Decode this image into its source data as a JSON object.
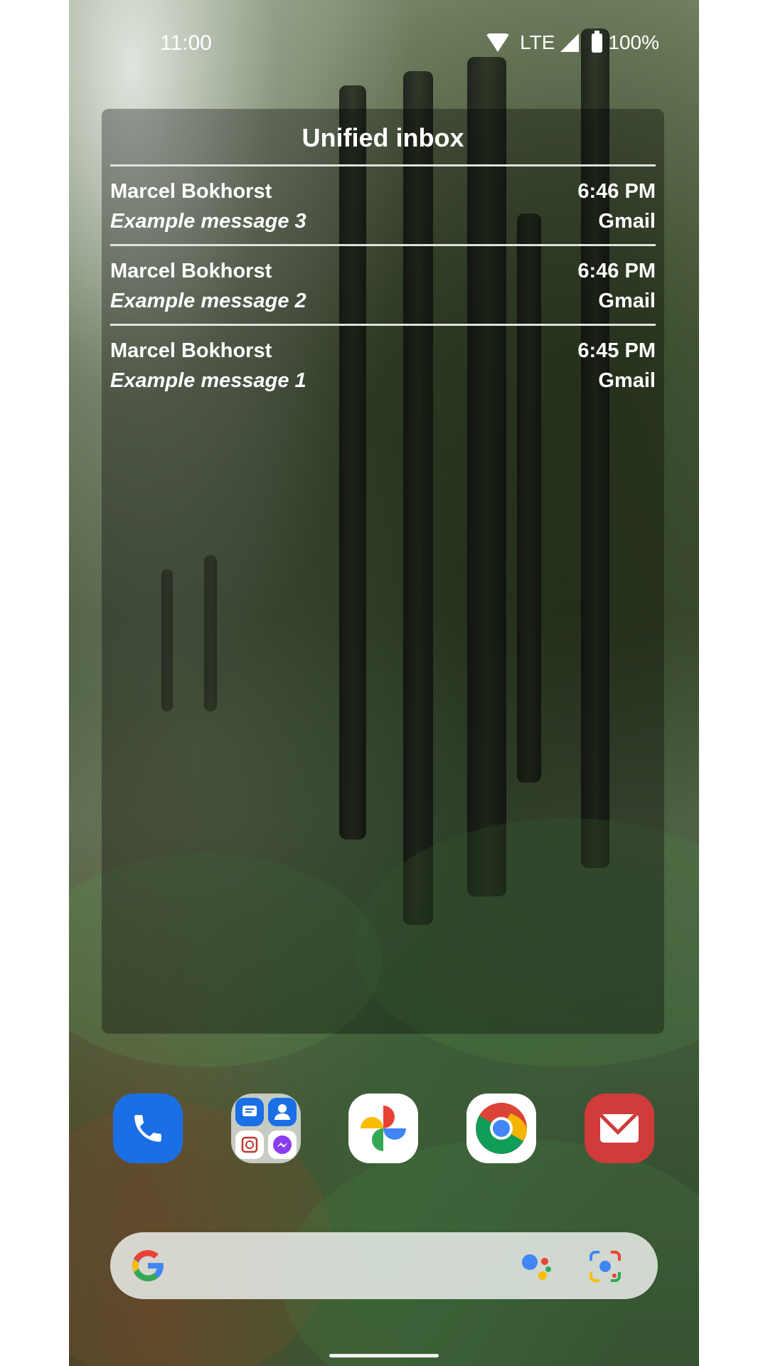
{
  "status_bar": {
    "time": "11:00",
    "network": "LTE",
    "battery": "100%"
  },
  "widget": {
    "title": "Unified inbox",
    "messages": [
      {
        "from": "Marcel Bokhorst",
        "time": "6:46 PM",
        "subject": "Example message 3",
        "account": "Gmail"
      },
      {
        "from": "Marcel Bokhorst",
        "time": "6:46 PM",
        "subject": "Example message 2",
        "account": "Gmail"
      },
      {
        "from": "Marcel Bokhorst",
        "time": "6:45 PM",
        "subject": "Example message 1",
        "account": "Gmail"
      }
    ]
  },
  "dock": {
    "icons": [
      "phone-icon",
      "folder-icon",
      "photos-icon",
      "chrome-icon",
      "email-icon"
    ]
  },
  "search": {
    "icons": [
      "google-g-icon",
      "assistant-icon",
      "lens-icon"
    ]
  },
  "colors": {
    "phone_app": "#1a6fe6",
    "email_app": "#d13b3b"
  }
}
